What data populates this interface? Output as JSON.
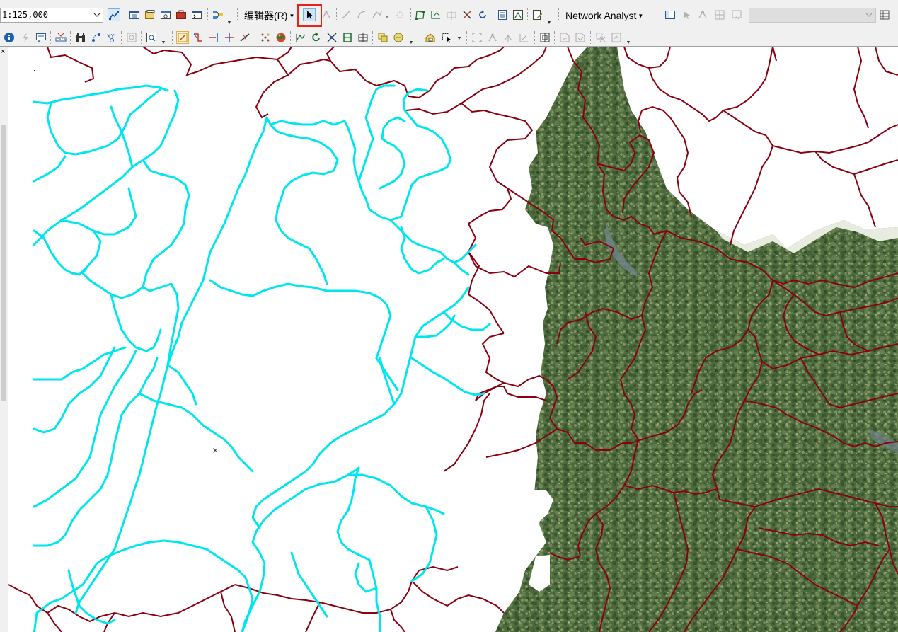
{
  "toolbar": {
    "scale_value": "1:125,000",
    "editor_label": "编辑器(R)",
    "network_analyst_label": "Network Analyst",
    "highlighted_tool": "edit-tool-pointer",
    "highlight_color": "#e8211b"
  },
  "map": {
    "center_marker": "×",
    "raster_colors": {
      "forest_dark": "#3e5a32",
      "forest_mid": "#587447",
      "forest_light": "#7e925e",
      "water": "#6f8287"
    },
    "road_color": "#00e6ee",
    "boundary_color": "#8a0010"
  },
  "icons": [
    "select-elements-icon",
    "full-extent-icon",
    "layout-view-icon",
    "html-popup-icon",
    "network-analyst-window-icon"
  ]
}
